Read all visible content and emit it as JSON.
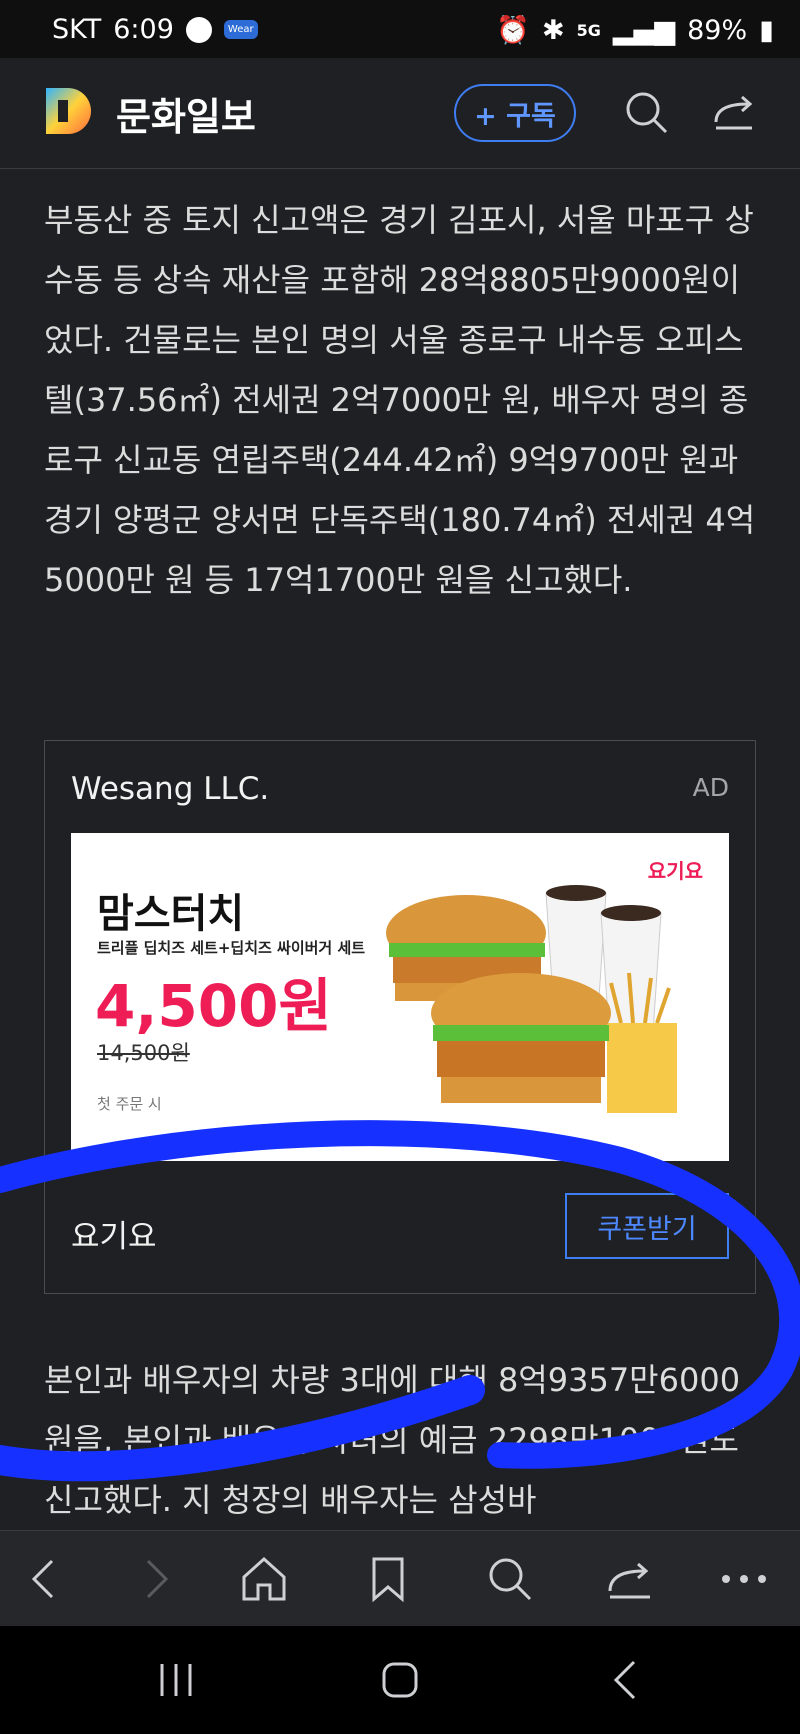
{
  "status_bar": {
    "carrier": "SKT",
    "time": "6:09",
    "wear_label": "Wear",
    "network": "5G",
    "battery": "89%"
  },
  "header": {
    "logo_letter": "D",
    "site_name": "문화일보",
    "subscribe_label": "+ 구독"
  },
  "article": {
    "paragraph_1": "부동산 중 토지 신고액은 경기 김포시, 서울 마포구 상수동 등 상속 재산을 포함해 28억8805만9000원이었다. 건물로는 본인 명의 서울 종로구 내수동 오피스텔(37.56㎡) 전세권 2억7000만 원, 배우자 명의 종로구 신교동 연립주택(244.42㎡) 9억9700만 원과 경기 양평군 양서면 단독주택(180.74㎡) 전세권 4억5000만 원 등 17억1700만 원을 신고했다.",
    "paragraph_2": "본인과 배우자의 차량 3대에 대해 8억9357만6000원을, 본인과 배우자·차녀의 예금 2298만1000원도 신고했다. 지 청장의 배우자는 삼성바"
  },
  "ad": {
    "advertiser": "Wesang LLC.",
    "tag": "AD",
    "banner_brand": "요기요",
    "banner_title": "맘스터치",
    "banner_subtitle": "트리플 딥치즈 세트+딥치즈 싸이버거 세트",
    "banner_price": "4,500원",
    "banner_old_price": "14,500원",
    "banner_note": "첫 주문 시",
    "footer_name": "요기요",
    "cta_label": "쿠폰받기"
  },
  "colors": {
    "accent": "#3f7df2",
    "price_red": "#ee1d56",
    "scribble": "#1631ff"
  }
}
